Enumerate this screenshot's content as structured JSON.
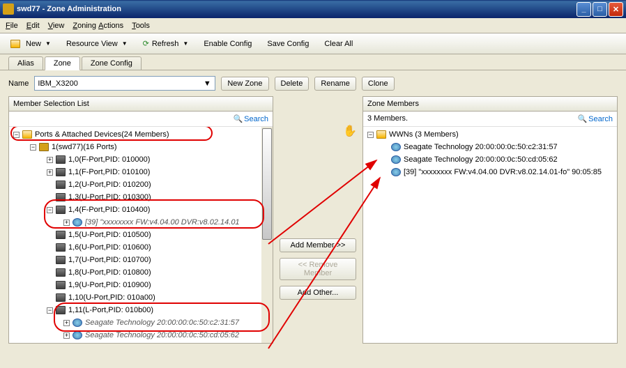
{
  "window": {
    "title": "swd77 - Zone Administration"
  },
  "menu": {
    "file": "File",
    "edit": "Edit",
    "view": "View",
    "zoning": "Zoning Actions",
    "tools": "Tools"
  },
  "toolbar": {
    "new": "New",
    "resource": "Resource View",
    "refresh": "Refresh",
    "enable": "Enable Config",
    "save": "Save Config",
    "clear": "Clear All"
  },
  "tabs": {
    "alias": "Alias",
    "zone": "Zone",
    "zonecfg": "Zone Config"
  },
  "name_row": {
    "label": "Name",
    "value": "IBM_X3200",
    "new_zone": "New Zone",
    "delete": "Delete",
    "rename": "Rename",
    "clone": "Clone"
  },
  "left": {
    "title": "Member Selection List",
    "search": "Search",
    "root": "Ports & Attached Devices(24 Members)",
    "switch": "1(swd77)(16 Ports)",
    "ports": [
      "1,0(F-Port,PID: 010000)",
      "1,1(F-Port,PID: 010100)",
      "1,2(U-Port,PID: 010200)",
      "1,3(U-Port,PID: 010300)",
      "1,4(F-Port,PID: 010400)"
    ],
    "dev1_4": "[39] \"xxxxxxxx FW:v4.04.00 DVR:v8.02.14.01",
    "ports2": [
      "1,5(U-Port,PID: 010500)",
      "1,6(U-Port,PID: 010600)",
      "1,7(U-Port,PID: 010700)",
      "1,8(U-Port,PID: 010800)",
      "1,9(U-Port,PID: 010900)",
      "1,10(U-Port,PID: 010a00)",
      "1,11(L-Port,PID: 010b00)"
    ],
    "seagate1": "Seagate Technology 20:00:00:0c:50:c2:31:57",
    "seagate2": "Seagate Technology 20:00:00:0c:50:cd:05:62"
  },
  "mid": {
    "add": "Add Member >>",
    "remove": "<< Remove Member",
    "other": "Add Other..."
  },
  "right": {
    "title": "Zone Members",
    "count": "3 Members.",
    "search": "Search",
    "root": "WWNs (3 Members)",
    "m1": "Seagate Technology 20:00:00:0c:50:c2:31:57",
    "m2": "Seagate Technology 20:00:00:0c:50:cd:05:62",
    "m3": "[39] \"xxxxxxxx FW:v4.04.00 DVR:v8.02.14.01-fo\" 90:05:85"
  }
}
